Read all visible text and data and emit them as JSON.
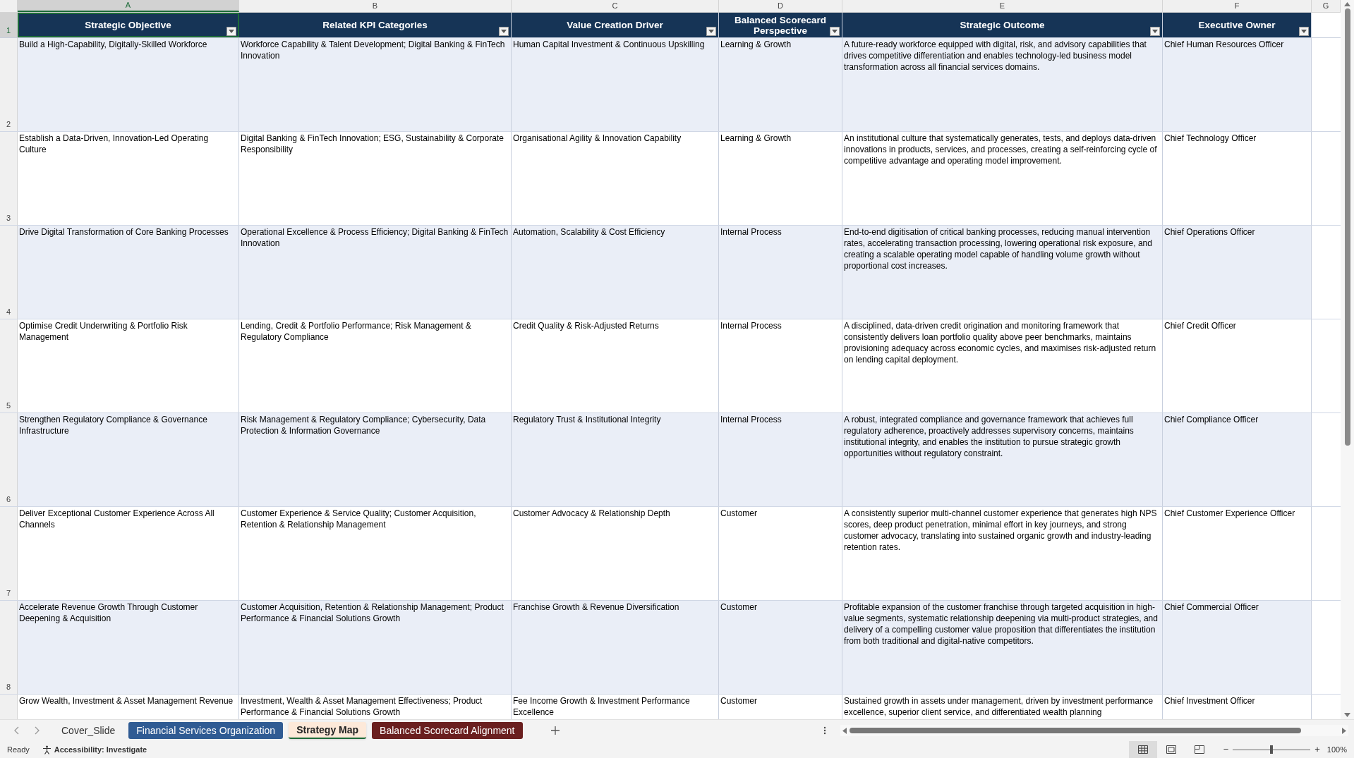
{
  "columns": [
    {
      "letter": "A",
      "title": "Strategic Objective",
      "selected": true
    },
    {
      "letter": "B",
      "title": "Related KPI Categories",
      "selected": false
    },
    {
      "letter": "C",
      "title": "Value Creation Driver",
      "selected": false
    },
    {
      "letter": "D",
      "title": "Balanced Scorecard Perspective",
      "selected": false
    },
    {
      "letter": "E",
      "title": "Strategic Outcome",
      "selected": false
    },
    {
      "letter": "F",
      "title": "Executive Owner",
      "selected": false
    },
    {
      "letter": "G",
      "selected": false
    }
  ],
  "header_row": {
    "number": "1",
    "selected": true
  },
  "rows": [
    {
      "number": "2",
      "cells": [
        "Build a High-Capability, Digitally-Skilled Workforce",
        "Workforce Capability & Talent Development; Digital Banking & FinTech Innovation",
        "Human Capital Investment & Continuous Upskilling",
        "Learning & Growth",
        "A future-ready workforce equipped with digital, risk, and advisory capabilities that drives competitive differentiation and enables technology-led business model transformation across all financial services domains.",
        "Chief Human Resources Officer"
      ]
    },
    {
      "number": "3",
      "cells": [
        "Establish a Data-Driven, Innovation-Led Operating Culture",
        "Digital Banking & FinTech Innovation; ESG, Sustainability & Corporate Responsibility",
        "Organisational Agility & Innovation Capability",
        "Learning & Growth",
        "An institutional culture that systematically generates, tests, and deploys data-driven innovations in products, services, and processes, creating a self-reinforcing cycle of competitive advantage and operating model improvement.",
        "Chief Technology Officer"
      ]
    },
    {
      "number": "4",
      "cells": [
        "Drive Digital Transformation of Core Banking Processes",
        "Operational Excellence & Process Efficiency; Digital Banking & FinTech Innovation",
        "Automation, Scalability & Cost Efficiency",
        "Internal Process",
        "End-to-end digitisation of critical banking processes, reducing manual intervention rates, accelerating transaction processing, lowering operational risk exposure, and creating a scalable operating model capable of handling volume growth without proportional cost increases.",
        "Chief Operations Officer"
      ]
    },
    {
      "number": "5",
      "cells": [
        "Optimise Credit Underwriting & Portfolio Risk Management",
        "Lending, Credit & Portfolio Performance; Risk Management & Regulatory Compliance",
        "Credit Quality & Risk-Adjusted Returns",
        "Internal Process",
        "A disciplined, data-driven credit origination and monitoring framework that consistently delivers loan portfolio quality above peer benchmarks, maintains provisioning adequacy across economic cycles, and maximises risk-adjusted return on lending capital deployment.",
        "Chief Credit Officer"
      ]
    },
    {
      "number": "6",
      "cells": [
        "Strengthen Regulatory Compliance & Governance Infrastructure",
        "Risk Management & Regulatory Compliance; Cybersecurity, Data Protection & Information Governance",
        "Regulatory Trust & Institutional Integrity",
        "Internal Process",
        "A robust, integrated compliance and governance framework that achieves full regulatory adherence, proactively addresses supervisory concerns, maintains institutional integrity, and enables the institution to pursue strategic growth opportunities without regulatory constraint.",
        "Chief Compliance Officer"
      ]
    },
    {
      "number": "7",
      "cells": [
        "Deliver Exceptional Customer Experience Across All Channels",
        "Customer Experience & Service Quality; Customer Acquisition, Retention & Relationship Management",
        "Customer Advocacy & Relationship Depth",
        "Customer",
        "A consistently superior multi-channel customer experience that generates high NPS scores, deep product penetration, minimal effort in key journeys, and strong customer advocacy, translating into sustained organic growth and industry-leading retention rates.",
        "Chief Customer Experience Officer"
      ]
    },
    {
      "number": "8",
      "cells": [
        "Accelerate Revenue Growth Through Customer Deepening & Acquisition",
        "Customer Acquisition, Retention & Relationship Management; Product Performance & Financial Solutions Growth",
        "Franchise Growth & Revenue Diversification",
        "Customer",
        "Profitable expansion of the customer franchise through targeted acquisition in high-value segments, systematic relationship deepening via multi-product strategies, and delivery of a compelling customer value proposition that differentiates the institution from both traditional and digital-native competitors.",
        "Chief Commercial Officer"
      ]
    },
    {
      "cells": [
        "Grow Wealth, Investment & Asset Management Revenue",
        "Investment, Wealth & Asset Management Effectiveness; Product Performance & Financial Solutions Growth",
        "Fee Income Growth & Investment Performance Excellence",
        "Customer",
        "Sustained growth in assets under management, driven by investment performance excellence, superior client service, and differentiated wealth planning",
        "Chief Investment Officer"
      ]
    }
  ],
  "sheet_tabs": [
    {
      "label": "Cover_Slide",
      "selected": false
    },
    {
      "label": "Financial Services Organization",
      "selected": false,
      "color": "#2f5b93"
    },
    {
      "label": "Strategy Map",
      "selected": true
    },
    {
      "label": "Balanced Scorecard Alignment",
      "selected": false,
      "color": "#6a1f1f"
    }
  ],
  "status_bar": {
    "ready": "Ready",
    "accessibility": "Accessibility: Investigate",
    "views": [
      {
        "kind": "normal",
        "selected": true
      },
      {
        "kind": "page_layout",
        "selected": false
      },
      {
        "kind": "page_break",
        "selected": false
      }
    ],
    "zoom": {
      "minus": "−",
      "plus": "+",
      "level": 0.5,
      "reading": "100%"
    }
  }
}
